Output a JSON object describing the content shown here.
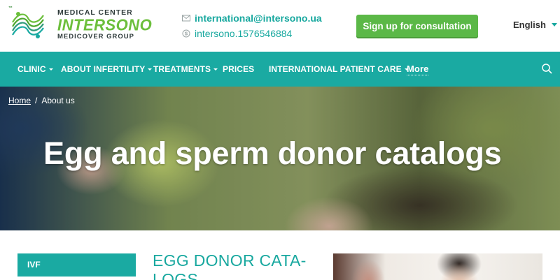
{
  "header": {
    "logo": {
      "tm": "™",
      "line1": "MEDICAL CENTER",
      "line2": "INTERSONO",
      "line3": "MEDICOVER GROUP"
    },
    "email": "international@intersono.ua",
    "skype": "intersono.1576546884",
    "signup_label": "Sign up for consultation",
    "language": "English"
  },
  "nav": {
    "items": [
      {
        "label": "CLINIC",
        "has_dropdown": true
      },
      {
        "label": "ABOUT INFERTILITY",
        "has_dropdown": true
      },
      {
        "label": "TREATMENTS",
        "has_dropdown": true
      },
      {
        "label": "PRICES",
        "has_dropdown": false
      },
      {
        "label": "INTERNATIONAL PATIENT CARE",
        "has_dropdown": true
      },
      {
        "label": "More",
        "has_dropdown": false
      }
    ],
    "search_icon": "search-icon"
  },
  "hero": {
    "breadcrumb": {
      "home": "Home",
      "separator": "/",
      "current": "About us"
    },
    "title": "Egg and sperm donor catalogs"
  },
  "sidebar": {
    "active_item": "IVF"
  },
  "content": {
    "title": "EGG DONOR CATA-LOGS"
  },
  "colors": {
    "teal": "#1aaaa2",
    "teal_text": "#18a89f",
    "green_button": "#5bb847",
    "logo_green": "#6cbf3c"
  }
}
